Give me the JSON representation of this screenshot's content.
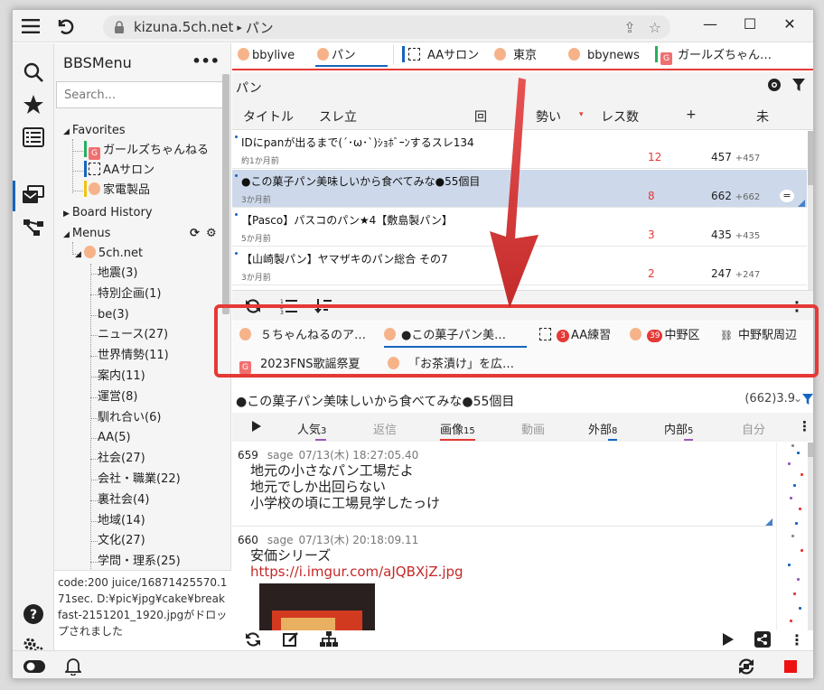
{
  "window": {
    "url_host": "kizuna.5ch.net",
    "url_sep": "▸",
    "url_path": "パン"
  },
  "sidebar": {
    "title": "BBSMenu",
    "more": "•••",
    "search_placeholder": "Search...",
    "favorites_label": "Favorites",
    "favorites": [
      {
        "label": "ガールズちゃんねる",
        "color": "#27ae60"
      },
      {
        "label": "AAサロン",
        "color": "#1565c0"
      },
      {
        "label": "家電製品",
        "color": "#f1c40f"
      }
    ],
    "board_history_label": "Board History",
    "menus_label": "Menus",
    "menu_root": "5ch.net",
    "menu_items": [
      "地震(3)",
      "特別企画(1)",
      "be(3)",
      "ニュース(27)",
      "世界情勢(11)",
      "案内(11)",
      "運営(8)",
      "馴れ合い(6)",
      "AA(5)",
      "社会(27)",
      "会社・職業(22)",
      "裏社会(4)",
      "地域(14)",
      "文化(27)",
      "学問・理系(25)"
    ],
    "status": "code:200 juice/16871425570.171sec. D:¥pic¥jpg¥cake¥breakfast-2151201_1920.jpgがドロップされました"
  },
  "tabs": [
    {
      "label": "bbylive",
      "active": false
    },
    {
      "label": "パン",
      "active": true
    },
    {
      "label": "AAサロン",
      "active": false
    },
    {
      "label": "東京",
      "active": false
    },
    {
      "label": "bbynews",
      "active": false
    },
    {
      "label": "ガールズちゃん…",
      "active": false
    }
  ],
  "board": {
    "title": "パン",
    "columns": {
      "title": "タイトル",
      "start": "スレ立",
      "times": "回",
      "momentum": "勢い",
      "sort_mark": "▾",
      "res": "レス数",
      "plus": "+",
      "end": "未"
    }
  },
  "threads": [
    {
      "title": "IDにpanが出るまで(´･ω･`)ｼｮﾎﾞｰﾝするスレ134",
      "age": "約1か月前",
      "count": "12",
      "total": "457",
      "inc": "+457"
    },
    {
      "title": "●この菓子パン美味しいから食べてみな●55個目",
      "age": "3か月前",
      "count": "8",
      "total": "662",
      "inc": "+662"
    },
    {
      "title": "【Pasco】パスコのパン★4【敷島製パン】",
      "age": "5か月前",
      "count": "3",
      "total": "435",
      "inc": "+435"
    },
    {
      "title": "【山崎製パン】ヤマザキのパン総合 その7",
      "age": "3か月前",
      "count": "2",
      "total": "247",
      "inc": "+247"
    }
  ],
  "thread_tabs": [
    {
      "label": "５ちゃんねるのア…",
      "badge": ""
    },
    {
      "label": "●この菓子パン美…",
      "badge": ""
    },
    {
      "label": "AA練習",
      "badge": "3"
    },
    {
      "label": "中野区",
      "badge": "39"
    },
    {
      "label": "中野駅周辺",
      "badge": ""
    },
    {
      "label": "2023FNS歌謡祭夏",
      "badge": ""
    },
    {
      "label": "「お茶漬け」を広…",
      "badge": ""
    }
  ],
  "thread_view": {
    "title": "●この菓子パン美味しいから食べてみな●55個目",
    "count": "(662)3.9",
    "filters": [
      {
        "label": "人気",
        "n": "3",
        "color": "#9b59b6"
      },
      {
        "label": "返信",
        "n": "",
        "color": ""
      },
      {
        "label": "画像",
        "n": "15",
        "color": "#e53935"
      },
      {
        "label": "動画",
        "n": "",
        "color": ""
      },
      {
        "label": "外部",
        "n": "8",
        "color": "#1565c0"
      },
      {
        "label": "内部",
        "n": "5",
        "color": "#9b59b6"
      },
      {
        "label": "自分",
        "n": "",
        "color": ""
      }
    ]
  },
  "posts": [
    {
      "num": "659",
      "name": "sage",
      "date": "07/13(木) 18:27:05.40",
      "lines": "地元の小さなパン工場だよ\n地元でしか出回らない\n小学校の頃に工場見学したっけ",
      "link": ""
    },
    {
      "num": "660",
      "name": "sage",
      "date": "07/13(木) 20:18:09.11",
      "lines": "安価シリーズ",
      "link": "https://i.imgur.com/aJQBXjZ.jpg"
    }
  ],
  "colors": {
    "accent": "#1565c0",
    "highlight": "#e53935",
    "selected_row": "#cdd9ea"
  }
}
